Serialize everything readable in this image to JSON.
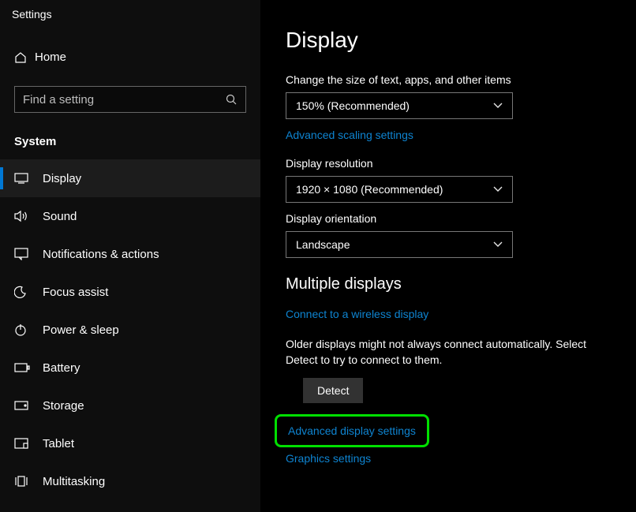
{
  "window_title": "Settings",
  "home_label": "Home",
  "search": {
    "placeholder": "Find a setting"
  },
  "section_header": "System",
  "nav": [
    {
      "label": "Display"
    },
    {
      "label": "Sound"
    },
    {
      "label": "Notifications & actions"
    },
    {
      "label": "Focus assist"
    },
    {
      "label": "Power & sleep"
    },
    {
      "label": "Battery"
    },
    {
      "label": "Storage"
    },
    {
      "label": "Tablet"
    },
    {
      "label": "Multitasking"
    }
  ],
  "main": {
    "page_title": "Display",
    "scale_label": "Change the size of text, apps, and other items",
    "scale_value": "150% (Recommended)",
    "adv_scaling_link": "Advanced scaling settings",
    "resolution_label": "Display resolution",
    "resolution_value": "1920 × 1080 (Recommended)",
    "orientation_label": "Display orientation",
    "orientation_value": "Landscape",
    "multi_title": "Multiple displays",
    "wireless_link": "Connect to a wireless display",
    "detect_note": "Older displays might not always connect automatically. Select Detect to try to connect to them.",
    "detect_label": "Detect",
    "adv_display_link": "Advanced display settings",
    "graphics_link": "Graphics settings"
  }
}
